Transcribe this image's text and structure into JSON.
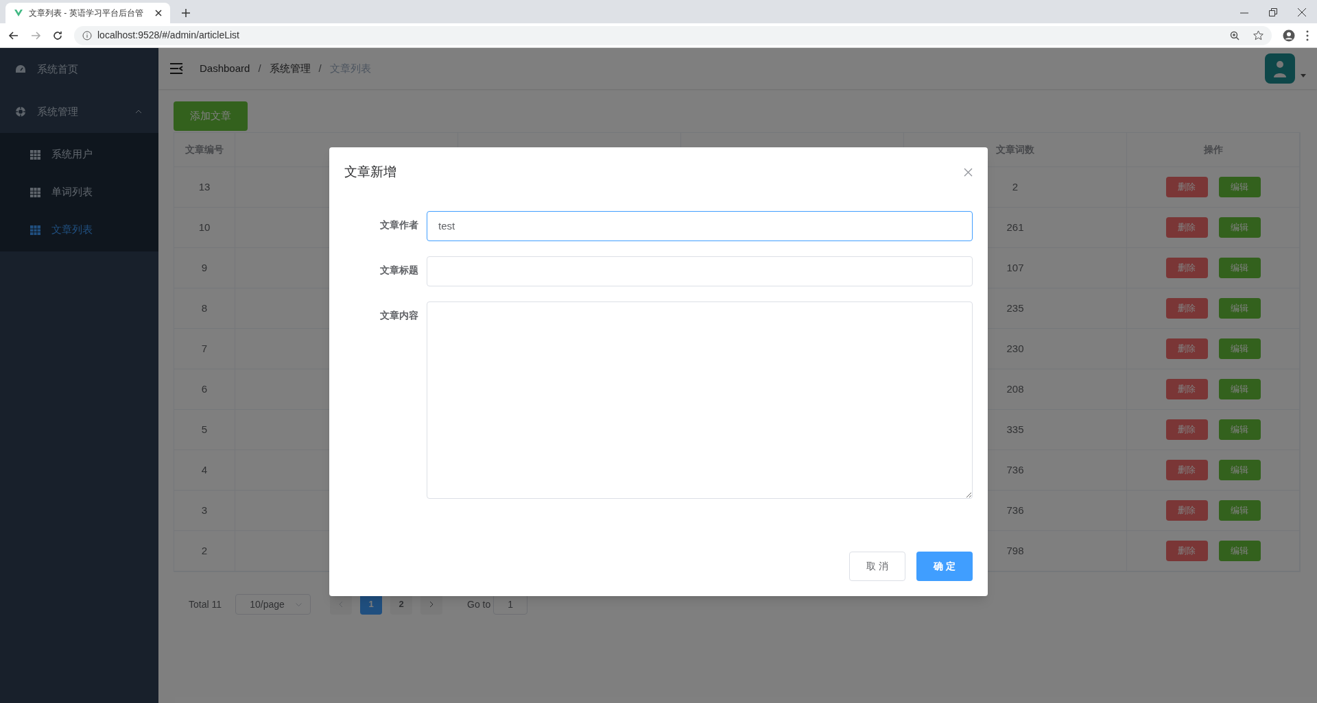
{
  "browser": {
    "tab_title": "文章列表 - 英语学习平台后台管",
    "url": "localhost:9528/#/admin/articleList"
  },
  "sidebar": {
    "items": [
      {
        "label": "系统首页",
        "kind": "link"
      },
      {
        "label": "系统管理",
        "kind": "group",
        "expanded": true,
        "children": [
          {
            "label": "系统用户",
            "selected": false
          },
          {
            "label": "单词列表",
            "selected": false
          },
          {
            "label": "文章列表",
            "selected": true
          }
        ]
      }
    ]
  },
  "breadcrumb": {
    "separator": "/",
    "items": [
      "Dashboard",
      "系统管理",
      "文章列表"
    ]
  },
  "add_button": "添加文章",
  "table": {
    "columns": {
      "id": "文章编号",
      "word_count": "文章词数",
      "actions": "操作"
    },
    "rows": [
      {
        "id": "13",
        "word_count": "2",
        "actions": [
          "删除",
          "编辑"
        ]
      },
      {
        "id": "10",
        "word_count": "261",
        "actions": [
          "删除",
          "编辑"
        ]
      },
      {
        "id": "9",
        "word_count": "107",
        "actions": [
          "删除",
          "编辑"
        ]
      },
      {
        "id": "8",
        "word_count": "235",
        "actions": [
          "删除",
          "编辑"
        ]
      },
      {
        "id": "7",
        "word_count": "230",
        "actions": [
          "删除",
          "编辑"
        ]
      },
      {
        "id": "6",
        "word_count": "208",
        "actions": [
          "删除",
          "编辑"
        ]
      },
      {
        "id": "5",
        "word_count": "335",
        "actions": [
          "删除",
          "编辑"
        ]
      },
      {
        "id": "4",
        "word_count": "736",
        "actions": [
          "删除",
          "编辑"
        ]
      },
      {
        "id": "3",
        "word_count": "736",
        "actions": [
          "删除",
          "编辑"
        ]
      },
      {
        "id": "2",
        "word_count": "798",
        "actions": [
          "删除",
          "编辑"
        ]
      }
    ]
  },
  "pagination": {
    "total": "Total 11",
    "page_size": "10/page",
    "pages": [
      {
        "label": "1",
        "selected": true
      },
      {
        "label": "2",
        "selected": false
      }
    ],
    "goto_label": "Go to",
    "goto_value": "1"
  },
  "dialog": {
    "title": "文章新增",
    "fields": [
      {
        "label": "文章作者",
        "kind": "input",
        "value": "test",
        "focused": true
      },
      {
        "label": "文章标题",
        "kind": "input",
        "focused": false
      },
      {
        "label": "文章内容",
        "kind": "textarea",
        "focused": false
      }
    ],
    "cancel": "取 消",
    "confirm": "确 定"
  }
}
